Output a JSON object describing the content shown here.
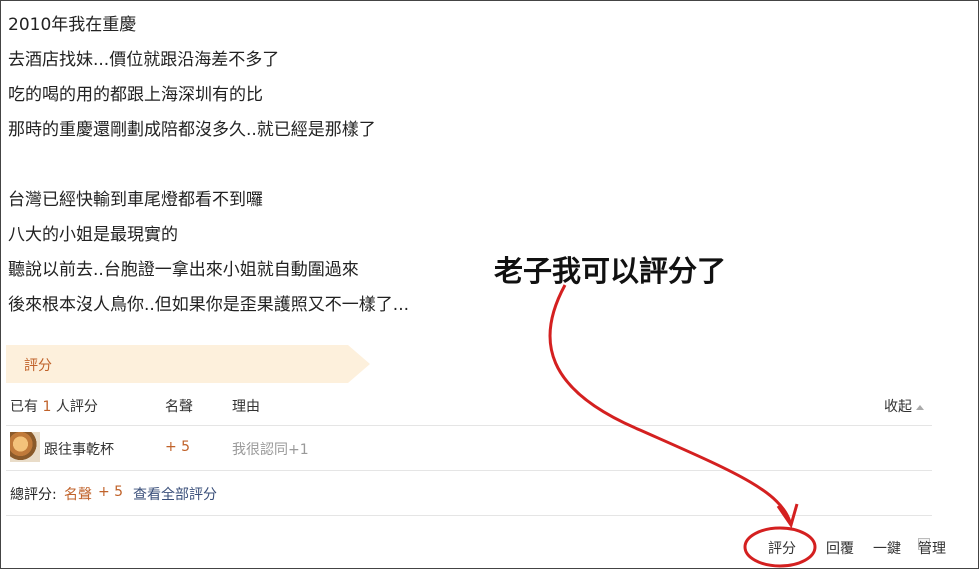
{
  "post": {
    "lines": [
      "2010年我在重慶",
      "去酒店找妹...價位就跟沿海差不多了",
      "吃的喝的用的都跟上海深圳有的比",
      "那時的重慶還剛劃成陪都沒多久..就已經是那樣了",
      "",
      "台灣已經快輸到車尾燈都看不到囉",
      "八大的小姐是最現實的",
      "聽說以前去..台胞證一拿出來小姐就自動圍過來",
      "後來根本沒人鳥你..但如果你是歪果護照又不一樣了..."
    ]
  },
  "rating": {
    "tab_label": "評分",
    "header": {
      "count_prefix": "已有",
      "count": "1",
      "count_suffix": "人評分",
      "col_reputation": "名聲",
      "col_reason": "理由",
      "collapse": "收起"
    },
    "entries": [
      {
        "user": "跟往事乾杯",
        "score": "+ 5",
        "reason": "我很認同+1"
      }
    ],
    "total": {
      "label": "總評分:",
      "reputation_label": "名聲",
      "reputation_value": "+ 5",
      "view_all": "查看全部評分"
    }
  },
  "annotation": {
    "text": "老子我可以評分了",
    "color": "#d42020"
  },
  "actions": {
    "rate": "評分",
    "reply": "回覆",
    "one": "一鍵",
    "manage": "管理"
  }
}
